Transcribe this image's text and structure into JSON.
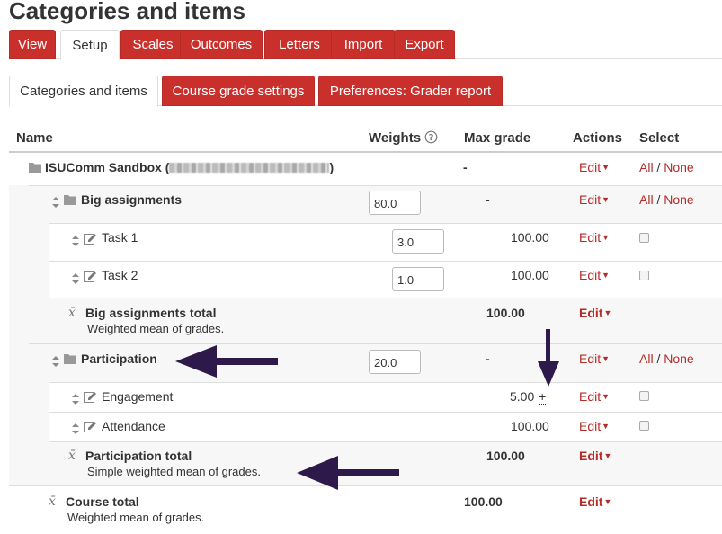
{
  "page_title": "Categories and items",
  "tabs_primary": [
    {
      "label": "View",
      "active": false
    },
    {
      "label": "Setup",
      "active": true
    },
    {
      "label": "Scales",
      "active": false
    },
    {
      "label": "Outcomes",
      "active": false
    },
    {
      "label": "Letters",
      "active": false
    },
    {
      "label": "Import",
      "active": false
    },
    {
      "label": "Export",
      "active": false
    }
  ],
  "tabs_secondary": [
    {
      "label": "Categories and items",
      "active": true
    },
    {
      "label": "Course grade settings",
      "active": false
    },
    {
      "label": "Preferences: Grader report",
      "active": false
    }
  ],
  "columns": {
    "name": "Name",
    "weights": "Weights",
    "max_grade": "Max grade",
    "actions": "Actions",
    "select": "Select"
  },
  "select_all": "All",
  "select_sep": "/",
  "select_none": "None",
  "edit_label": "Edit",
  "rows": {
    "course": {
      "name_prefix": "ISUComm Sandbox (",
      "name_suffix": ")",
      "max": "-"
    },
    "big": {
      "name": "Big assignments",
      "weight": "80.0",
      "max": "-"
    },
    "task1": {
      "name": "Task 1",
      "weight": "3.0",
      "max": "100.00"
    },
    "task2": {
      "name": "Task 2",
      "weight": "1.0",
      "max": "100.00"
    },
    "big_total": {
      "name": "Big assignments total",
      "sub": "Weighted mean of grades.",
      "max": "100.00"
    },
    "participation": {
      "name": "Participation",
      "weight": "20.0",
      "max": "-"
    },
    "engagement": {
      "name": "Engagement",
      "max": "5.00",
      "extra_credit": "+"
    },
    "attendance": {
      "name": "Attendance",
      "max": "100.00"
    },
    "part_total": {
      "name": "Participation total",
      "sub": "Simple weighted mean of grades.",
      "max": "100.00"
    },
    "course_total": {
      "name": "Course total",
      "sub": "Weighted mean of grades.",
      "max": "100.00"
    }
  },
  "colors": {
    "accent_red": "#c9302c",
    "link_red": "#b52b27",
    "annotation_arrow": "#2d1a4a"
  }
}
